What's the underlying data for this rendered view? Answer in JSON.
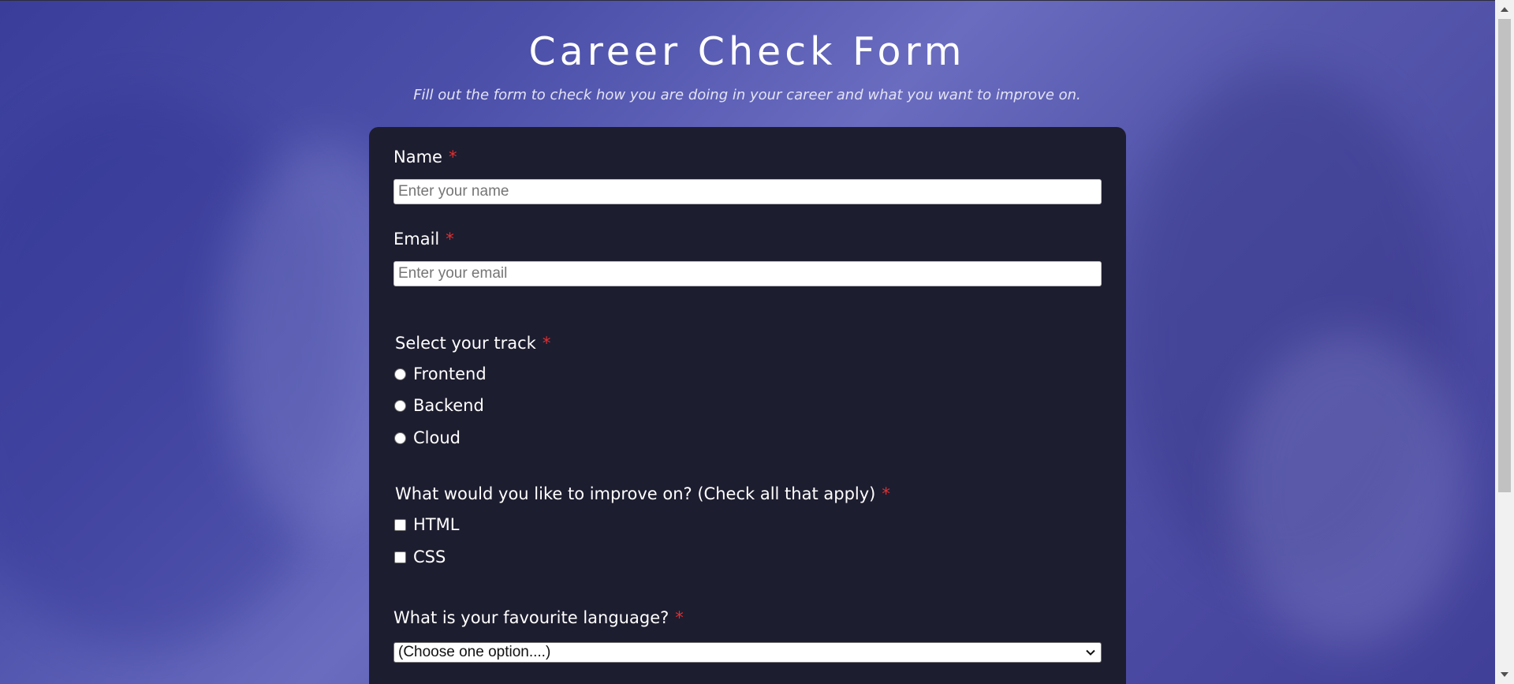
{
  "header": {
    "title": "Career Check Form",
    "subtitle": "Fill out the form to check how you are doing in your career and what you want to improve on."
  },
  "form": {
    "name": {
      "label": "Name",
      "required_mark": "*",
      "placeholder": "Enter your name",
      "value": ""
    },
    "email": {
      "label": "Email",
      "required_mark": "*",
      "placeholder": "Enter your email",
      "value": ""
    },
    "track": {
      "label": "Select your track",
      "required_mark": "*",
      "options": [
        "Frontend",
        "Backend",
        "Cloud"
      ]
    },
    "improve": {
      "label": "What would you like to improve on? (Check all that apply)",
      "required_mark": "*",
      "options": [
        "HTML",
        "CSS"
      ]
    },
    "language": {
      "label": "What is your favourite language?",
      "required_mark": "*",
      "selected": "(Choose one option....)"
    }
  },
  "colors": {
    "card_background": "#1d1d30",
    "required_mark": "#e03030",
    "page_background": "#4b4fa8"
  },
  "icons": {
    "select_arrow": "chevron-down-icon",
    "scroll_up": "triangle-up-icon",
    "scroll_down": "triangle-down-icon"
  }
}
